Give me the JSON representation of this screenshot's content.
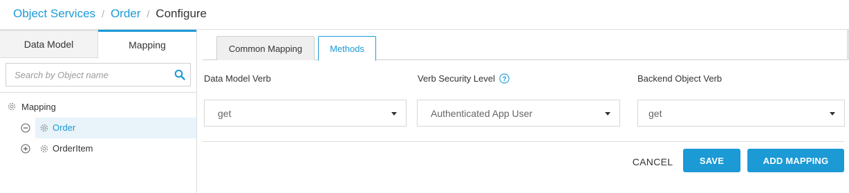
{
  "breadcrumb": {
    "items": [
      "Object Services",
      "Order"
    ],
    "separator": "/",
    "current": "Configure"
  },
  "left_tabs": {
    "data_model": "Data Model",
    "mapping": "Mapping"
  },
  "search": {
    "placeholder": "Search by Object name",
    "value": ""
  },
  "tree": {
    "root_label": "Mapping",
    "items": [
      {
        "label": "Order",
        "selected": true,
        "expanded": true
      },
      {
        "label": "OrderItem",
        "selected": false,
        "expanded": false
      }
    ]
  },
  "right_tabs": {
    "common_mapping": "Common Mapping",
    "methods": "Methods",
    "active": "Methods"
  },
  "fields": {
    "data_model_verb": {
      "label": "Data Model Verb",
      "value": "get"
    },
    "verb_security_level": {
      "label": "Verb Security Level",
      "value": "Authenticated App User"
    },
    "backend_object_verb": {
      "label": "Backend Object Verb",
      "value": "get"
    }
  },
  "actions": {
    "cancel": "CANCEL",
    "save": "SAVE",
    "add_mapping": "ADD MAPPING"
  },
  "colors": {
    "accent": "#1b9ad6",
    "selected_row_bg": "#e8f3fa",
    "tab_inactive_bg": "#efefef"
  },
  "icons": [
    "search-icon",
    "gear-icon",
    "collapse-icon",
    "expand-icon",
    "help-icon",
    "caret-down-icon"
  ]
}
